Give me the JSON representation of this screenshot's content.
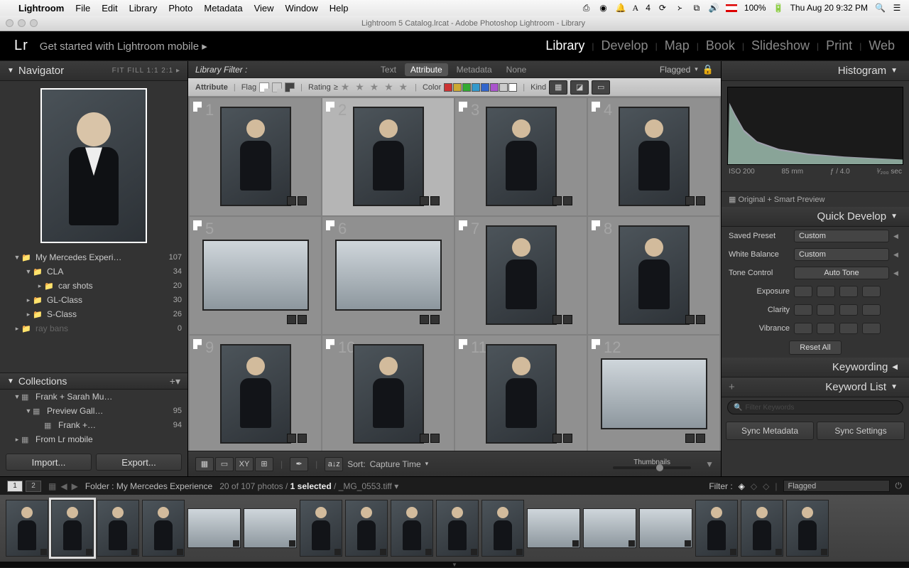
{
  "macbar": {
    "app": "Lightroom",
    "menus": [
      "File",
      "Edit",
      "Library",
      "Photo",
      "Metadata",
      "View",
      "Window",
      "Help"
    ],
    "battery": "100%",
    "datetime": "Thu Aug 20  9:32 PM",
    "countbadge": "4"
  },
  "window": {
    "title": "Lightroom 5 Catalog.lrcat - Adobe Photoshop Lightroom - Library"
  },
  "header": {
    "logo": "Lr",
    "getstarted": "Get started with Lightroom mobile  ▸",
    "modules": [
      "Library",
      "Develop",
      "Map",
      "Book",
      "Slideshow",
      "Print",
      "Web"
    ],
    "active": "Library"
  },
  "navigator": {
    "title": "Navigator",
    "zoom": "FIT   FILL   1:1    2:1  ▸"
  },
  "folders": [
    {
      "indent": 1,
      "tri": "▼",
      "icon": "📁",
      "name": "My Mercedes Experi…",
      "count": 107
    },
    {
      "indent": 2,
      "tri": "▼",
      "icon": "📁",
      "name": "CLA",
      "count": 34
    },
    {
      "indent": 3,
      "tri": "▸",
      "icon": "📁",
      "name": "car shots",
      "count": 20
    },
    {
      "indent": 2,
      "tri": "▸",
      "icon": "📁",
      "name": "GL-Class",
      "count": 30
    },
    {
      "indent": 2,
      "tri": "▸",
      "icon": "📁",
      "name": "S-Class",
      "count": 26
    },
    {
      "indent": 1,
      "tri": "▸",
      "icon": "📁",
      "name": "ray bans",
      "count": 0,
      "dim": true
    }
  ],
  "collectionshdr": "Collections",
  "collections": [
    {
      "indent": 1,
      "tri": "▼",
      "icon": "▦",
      "name": "Frank + Sarah Mu…",
      "count": ""
    },
    {
      "indent": 2,
      "tri": "▼",
      "icon": "▦",
      "name": "Preview Gall…",
      "count": 95
    },
    {
      "indent": 3,
      "tri": "",
      "icon": "▦",
      "name": "Frank +…",
      "count": 94
    },
    {
      "indent": 1,
      "tri": "▸",
      "icon": "▦",
      "name": "From Lr mobile",
      "count": ""
    }
  ],
  "buttons": {
    "import": "Import...",
    "export": "Export..."
  },
  "libfilter": {
    "label": "Library Filter :",
    "tabs": [
      "Text",
      "Attribute",
      "Metadata",
      "None"
    ],
    "active": "Attribute",
    "flagged": "Flagged"
  },
  "attrbar": {
    "attribute": "Attribute",
    "flag": "Flag",
    "rating": "Rating",
    "ge": "≥",
    "color": "Color",
    "kind": "Kind",
    "swatches": [
      "#c33",
      "#ca3",
      "#3a3",
      "#39c",
      "#36c",
      "#a5c",
      "#ccc",
      "#fff"
    ]
  },
  "grid": {
    "rows": 3,
    "cols": 4,
    "cells": [
      {
        "n": 1,
        "type": "portrait"
      },
      {
        "n": 2,
        "type": "portrait",
        "selected": true
      },
      {
        "n": 3,
        "type": "portrait"
      },
      {
        "n": 4,
        "type": "portrait"
      },
      {
        "n": 5,
        "type": "landscape"
      },
      {
        "n": 6,
        "type": "landscape"
      },
      {
        "n": 7,
        "type": "portrait"
      },
      {
        "n": 8,
        "type": "portrait"
      },
      {
        "n": 9,
        "type": "portrait"
      },
      {
        "n": 10,
        "type": "portrait"
      },
      {
        "n": 11,
        "type": "portrait"
      },
      {
        "n": 12,
        "type": "landscape"
      }
    ]
  },
  "toolbar": {
    "sortlabel": "Sort:",
    "sortval": "Capture Time",
    "thumbs": "Thumbnails"
  },
  "right": {
    "histogram": "Histogram",
    "histolabels": [
      "ISO 200",
      "85 mm",
      "ƒ / 4.0",
      "¹⁄₂₀₀ sec"
    ],
    "preview": "Original + Smart Preview",
    "quickdev": "Quick Develop",
    "savedpreset": "Saved Preset",
    "savedpresetval": "Custom",
    "whitebal": "White Balance",
    "whitebalval": "Custom",
    "tonecontrol": "Tone Control",
    "autotone": "Auto Tone",
    "exposure": "Exposure",
    "clarity": "Clarity",
    "vibrance": "Vibrance",
    "resetall": "Reset All",
    "keywording": "Keywording",
    "keywordlist": "Keyword List",
    "filterplaceholder": "Filter Keywords",
    "syncmeta": "Sync Metadata",
    "syncset": "Sync Settings"
  },
  "filmstrip": {
    "folder": "Folder : My Mercedes Experience",
    "count": "20 of 107 photos / ",
    "selected": "1 selected",
    "filename": " /  _MG_0553.tiff",
    "filterlabel": "Filter :",
    "flagged": "Flagged",
    "thumbs": [
      {
        "t": "p"
      },
      {
        "t": "p",
        "sel": true
      },
      {
        "t": "p"
      },
      {
        "t": "p"
      },
      {
        "t": "l"
      },
      {
        "t": "l"
      },
      {
        "t": "p"
      },
      {
        "t": "p"
      },
      {
        "t": "p"
      },
      {
        "t": "p"
      },
      {
        "t": "p"
      },
      {
        "t": "l"
      },
      {
        "t": "l"
      },
      {
        "t": "l"
      },
      {
        "t": "p"
      },
      {
        "t": "p"
      },
      {
        "t": "p"
      }
    ]
  }
}
